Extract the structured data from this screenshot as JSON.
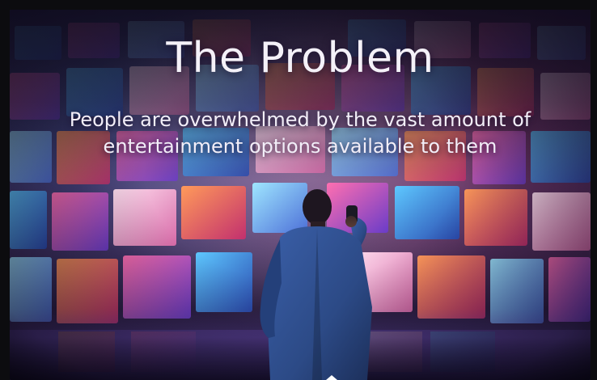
{
  "slide": {
    "title": "The Problem",
    "subtitle": "People are overwhelmed by the vast amount of entertainment options available to them"
  },
  "palette": {
    "text": "#f4f1f8",
    "backdrop_dark": "#1a1630",
    "accent_pink": "#ff5aa0",
    "accent_blue": "#5a8cff",
    "jacket": "#2c4a86"
  },
  "image": {
    "subject": "person-facing-screen-wall"
  }
}
